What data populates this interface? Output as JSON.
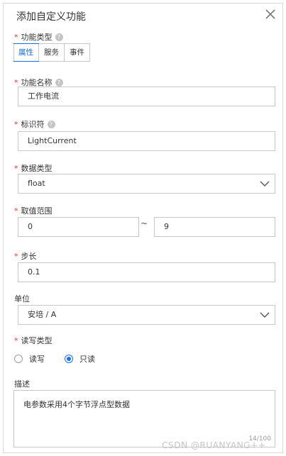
{
  "dialog": {
    "title": "添加自定义功能"
  },
  "fields": {
    "function_type": {
      "label": "功能类型",
      "options": [
        "属性",
        "服务",
        "事件"
      ],
      "selected": "属性"
    },
    "function_name": {
      "label": "功能名称",
      "value": "工作电流"
    },
    "identifier": {
      "label": "标识符",
      "value": "LightCurrent"
    },
    "data_type": {
      "label": "数据类型",
      "value": "float"
    },
    "range": {
      "label": "取值范围",
      "min": "0",
      "separator": "~",
      "max": "9"
    },
    "step": {
      "label": "步长",
      "value": "0.1"
    },
    "unit": {
      "label": "单位",
      "value": "安培 / A"
    },
    "access": {
      "label": "读写类型",
      "options": [
        "读写",
        "只读"
      ],
      "selected": "只读"
    },
    "description": {
      "label": "描述",
      "value": "电参数采用4个字节浮点型数据",
      "counter": "14/100"
    }
  },
  "watermark": "CSDN @RUANYANG++",
  "colors": {
    "accent": "#1570ef",
    "required": "#e53935",
    "border": "#c8c8c8"
  },
  "icons": {
    "close": "close-icon",
    "help": "help-icon",
    "dropdown": "chevron-down-icon"
  }
}
